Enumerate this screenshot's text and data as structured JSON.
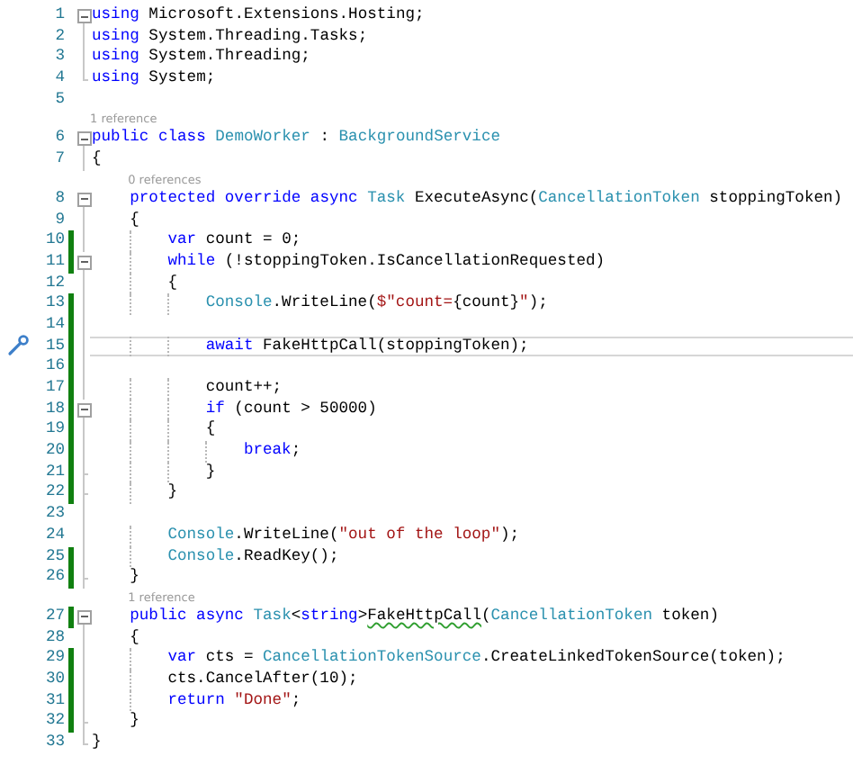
{
  "lines": [
    {
      "number": "1",
      "kind": "start",
      "changed": false,
      "current": false,
      "marker": false,
      "tokens": [
        {
          "kind": "keyword",
          "text": "using"
        },
        {
          "kind": "plain",
          "text": " Microsoft.Extensions.Hosting;"
        }
      ]
    },
    {
      "number": "2",
      "kind": "inner",
      "changed": false,
      "current": false,
      "marker": false,
      "tokens": [
        {
          "kind": "keyword",
          "text": "using"
        },
        {
          "kind": "plain",
          "text": " System.Threading.Tasks;"
        }
      ]
    },
    {
      "number": "3",
      "kind": "inner",
      "changed": false,
      "current": false,
      "marker": false,
      "tokens": [
        {
          "kind": "keyword",
          "text": "using"
        },
        {
          "kind": "plain",
          "text": " System.Threading;"
        }
      ]
    },
    {
      "number": "4",
      "kind": "end",
      "changed": false,
      "current": false,
      "marker": false,
      "tokens": [
        {
          "kind": "keyword",
          "text": "using"
        },
        {
          "kind": "plain",
          "text": " System;"
        }
      ]
    },
    {
      "number": "5",
      "kind": "plain",
      "changed": false,
      "current": false,
      "marker": false
    },
    {
      "number": "6",
      "lens": "1 reference",
      "kind": "start",
      "changed": false,
      "current": false,
      "marker": false,
      "tokens": [
        {
          "kind": "keyword",
          "text": "public class "
        },
        {
          "kind": "type",
          "text": "DemoWorker"
        },
        {
          "kind": "plain",
          "text": " : "
        },
        {
          "kind": "type",
          "text": "BackgroundService"
        }
      ]
    },
    {
      "number": "7",
      "kind": "inner",
      "changed": false,
      "current": false,
      "marker": false,
      "tokens": [
        {
          "kind": "plain",
          "text": "{"
        }
      ]
    },
    {
      "number": "8",
      "lens": "0 references",
      "kind": "start",
      "changed": false,
      "current": false,
      "marker": false,
      "tokens": [
        {
          "kind": "keyword",
          "text": "    protected override async "
        },
        {
          "kind": "type",
          "text": "Task"
        },
        {
          "kind": "plain",
          "text": " ExecuteAsync("
        },
        {
          "kind": "type",
          "text": "CancellationToken"
        },
        {
          "kind": "plain",
          "text": " stoppingToken)"
        }
      ]
    },
    {
      "number": "9",
      "kind": "inner",
      "changed": false,
      "current": false,
      "marker": false,
      "tokens": [
        {
          "kind": "plain",
          "text": "    {"
        }
      ]
    },
    {
      "number": "10",
      "kind": "inner",
      "changed": true,
      "current": false,
      "marker": false,
      "tokens": [
        {
          "kind": "keyword",
          "text": "        var"
        },
        {
          "kind": "plain",
          "text": " count = 0;"
        }
      ]
    },
    {
      "number": "11",
      "kind": "start",
      "changed": true,
      "current": false,
      "marker": false,
      "tokens": [
        {
          "kind": "keyword",
          "text": "        while"
        },
        {
          "kind": "plain",
          "text": " (!stoppingToken.IsCancellationRequested)"
        }
      ]
    },
    {
      "number": "12",
      "kind": "inner",
      "changed": false,
      "current": false,
      "marker": false,
      "tokens": [
        {
          "kind": "plain",
          "text": "        {"
        }
      ]
    },
    {
      "number": "13",
      "kind": "inner",
      "changed": true,
      "current": false,
      "marker": false,
      "tokens": [
        {
          "kind": "type",
          "text": "            Console"
        },
        {
          "kind": "plain",
          "text": ".WriteLine("
        },
        {
          "kind": "string",
          "text": "$\"count="
        },
        {
          "kind": "plain",
          "text": "{count}"
        },
        {
          "kind": "string",
          "text": "\""
        },
        {
          "kind": "plain",
          "text": ");"
        }
      ]
    },
    {
      "number": "14",
      "kind": "inner",
      "changed": true,
      "current": false,
      "marker": false
    },
    {
      "number": "15",
      "kind": "inner",
      "changed": true,
      "current": true,
      "marker": true,
      "tokens": [
        {
          "kind": "keyword",
          "text": "            await"
        },
        {
          "kind": "plain",
          "text": " FakeHttpCall(stoppingToken);"
        }
      ]
    },
    {
      "number": "16",
      "kind": "inner",
      "changed": true,
      "current": false,
      "marker": false
    },
    {
      "number": "17",
      "kind": "inner",
      "changed": true,
      "current": false,
      "marker": false,
      "tokens": [
        {
          "kind": "plain",
          "text": "            count++;"
        }
      ]
    },
    {
      "number": "18",
      "kind": "start",
      "changed": true,
      "current": false,
      "marker": false,
      "tokens": [
        {
          "kind": "keyword",
          "text": "            if"
        },
        {
          "kind": "plain",
          "text": " (count > 50000)"
        }
      ]
    },
    {
      "number": "19",
      "kind": "inner",
      "changed": true,
      "current": false,
      "marker": false,
      "tokens": [
        {
          "kind": "plain",
          "text": "            {"
        }
      ]
    },
    {
      "number": "20",
      "kind": "inner",
      "changed": true,
      "current": false,
      "marker": false,
      "tokens": [
        {
          "kind": "keyword",
          "text": "                break"
        },
        {
          "kind": "plain",
          "text": ";"
        }
      ]
    },
    {
      "number": "21",
      "kind": "tick",
      "changed": true,
      "current": false,
      "marker": false,
      "tokens": [
        {
          "kind": "plain",
          "text": "            }"
        }
      ]
    },
    {
      "number": "22",
      "kind": "tick",
      "changed": true,
      "current": false,
      "marker": false,
      "tokens": [
        {
          "kind": "plain",
          "text": "        }"
        }
      ]
    },
    {
      "number": "23",
      "kind": "inner",
      "changed": false,
      "current": false,
      "marker": false
    },
    {
      "number": "24",
      "kind": "inner",
      "changed": false,
      "current": false,
      "marker": false,
      "tokens": [
        {
          "kind": "type",
          "text": "        Console"
        },
        {
          "kind": "plain",
          "text": ".WriteLine("
        },
        {
          "kind": "string",
          "text": "\"out of the loop\""
        },
        {
          "kind": "plain",
          "text": ");"
        }
      ]
    },
    {
      "number": "25",
      "kind": "inner",
      "changed": true,
      "current": false,
      "marker": false,
      "tokens": [
        {
          "kind": "type",
          "text": "        Console"
        },
        {
          "kind": "plain",
          "text": ".ReadKey();"
        }
      ]
    },
    {
      "number": "26",
      "kind": "tick",
      "changed": true,
      "current": false,
      "marker": false,
      "tokens": [
        {
          "kind": "plain",
          "text": "    }"
        }
      ]
    },
    {
      "number": "27",
      "lens": "1 reference",
      "kind": "start",
      "changed": true,
      "current": false,
      "marker": false,
      "tokens": [
        {
          "kind": "keyword",
          "text": "    public async "
        },
        {
          "kind": "type",
          "text": "Task"
        },
        {
          "kind": "plain",
          "text": "<"
        },
        {
          "kind": "keyword",
          "text": "string"
        },
        {
          "kind": "plain",
          "text": ">"
        },
        {
          "kind": "flagged",
          "text": "FakeHttpCall"
        },
        {
          "kind": "plain",
          "text": "("
        },
        {
          "kind": "type",
          "text": "CancellationToken"
        },
        {
          "kind": "plain",
          "text": " token)"
        }
      ]
    },
    {
      "number": "28",
      "kind": "inner",
      "changed": false,
      "current": false,
      "marker": false,
      "tokens": [
        {
          "kind": "plain",
          "text": "    {"
        }
      ]
    },
    {
      "number": "29",
      "kind": "inner",
      "changed": true,
      "current": false,
      "marker": false,
      "tokens": [
        {
          "kind": "keyword",
          "text": "        var"
        },
        {
          "kind": "plain",
          "text": " cts = "
        },
        {
          "kind": "type",
          "text": "CancellationTokenSource"
        },
        {
          "kind": "plain",
          "text": ".CreateLinkedTokenSource(token);"
        }
      ]
    },
    {
      "number": "30",
      "kind": "inner",
      "changed": true,
      "current": false,
      "marker": false,
      "tokens": [
        {
          "kind": "plain",
          "text": "        cts.CancelAfter(10);"
        }
      ]
    },
    {
      "number": "31",
      "kind": "inner",
      "changed": true,
      "current": false,
      "marker": false,
      "tokens": [
        {
          "kind": "keyword",
          "text": "        return "
        },
        {
          "kind": "string",
          "text": "\"Done\""
        },
        {
          "kind": "plain",
          "text": ";"
        }
      ]
    },
    {
      "number": "32",
      "kind": "tick",
      "changed": true,
      "current": false,
      "marker": false,
      "tokens": [
        {
          "kind": "plain",
          "text": "    }"
        }
      ]
    },
    {
      "number": "33",
      "kind": "end",
      "changed": false,
      "current": false,
      "marker": false,
      "tokens": [
        {
          "kind": "plain",
          "text": "}"
        }
      ]
    }
  ]
}
